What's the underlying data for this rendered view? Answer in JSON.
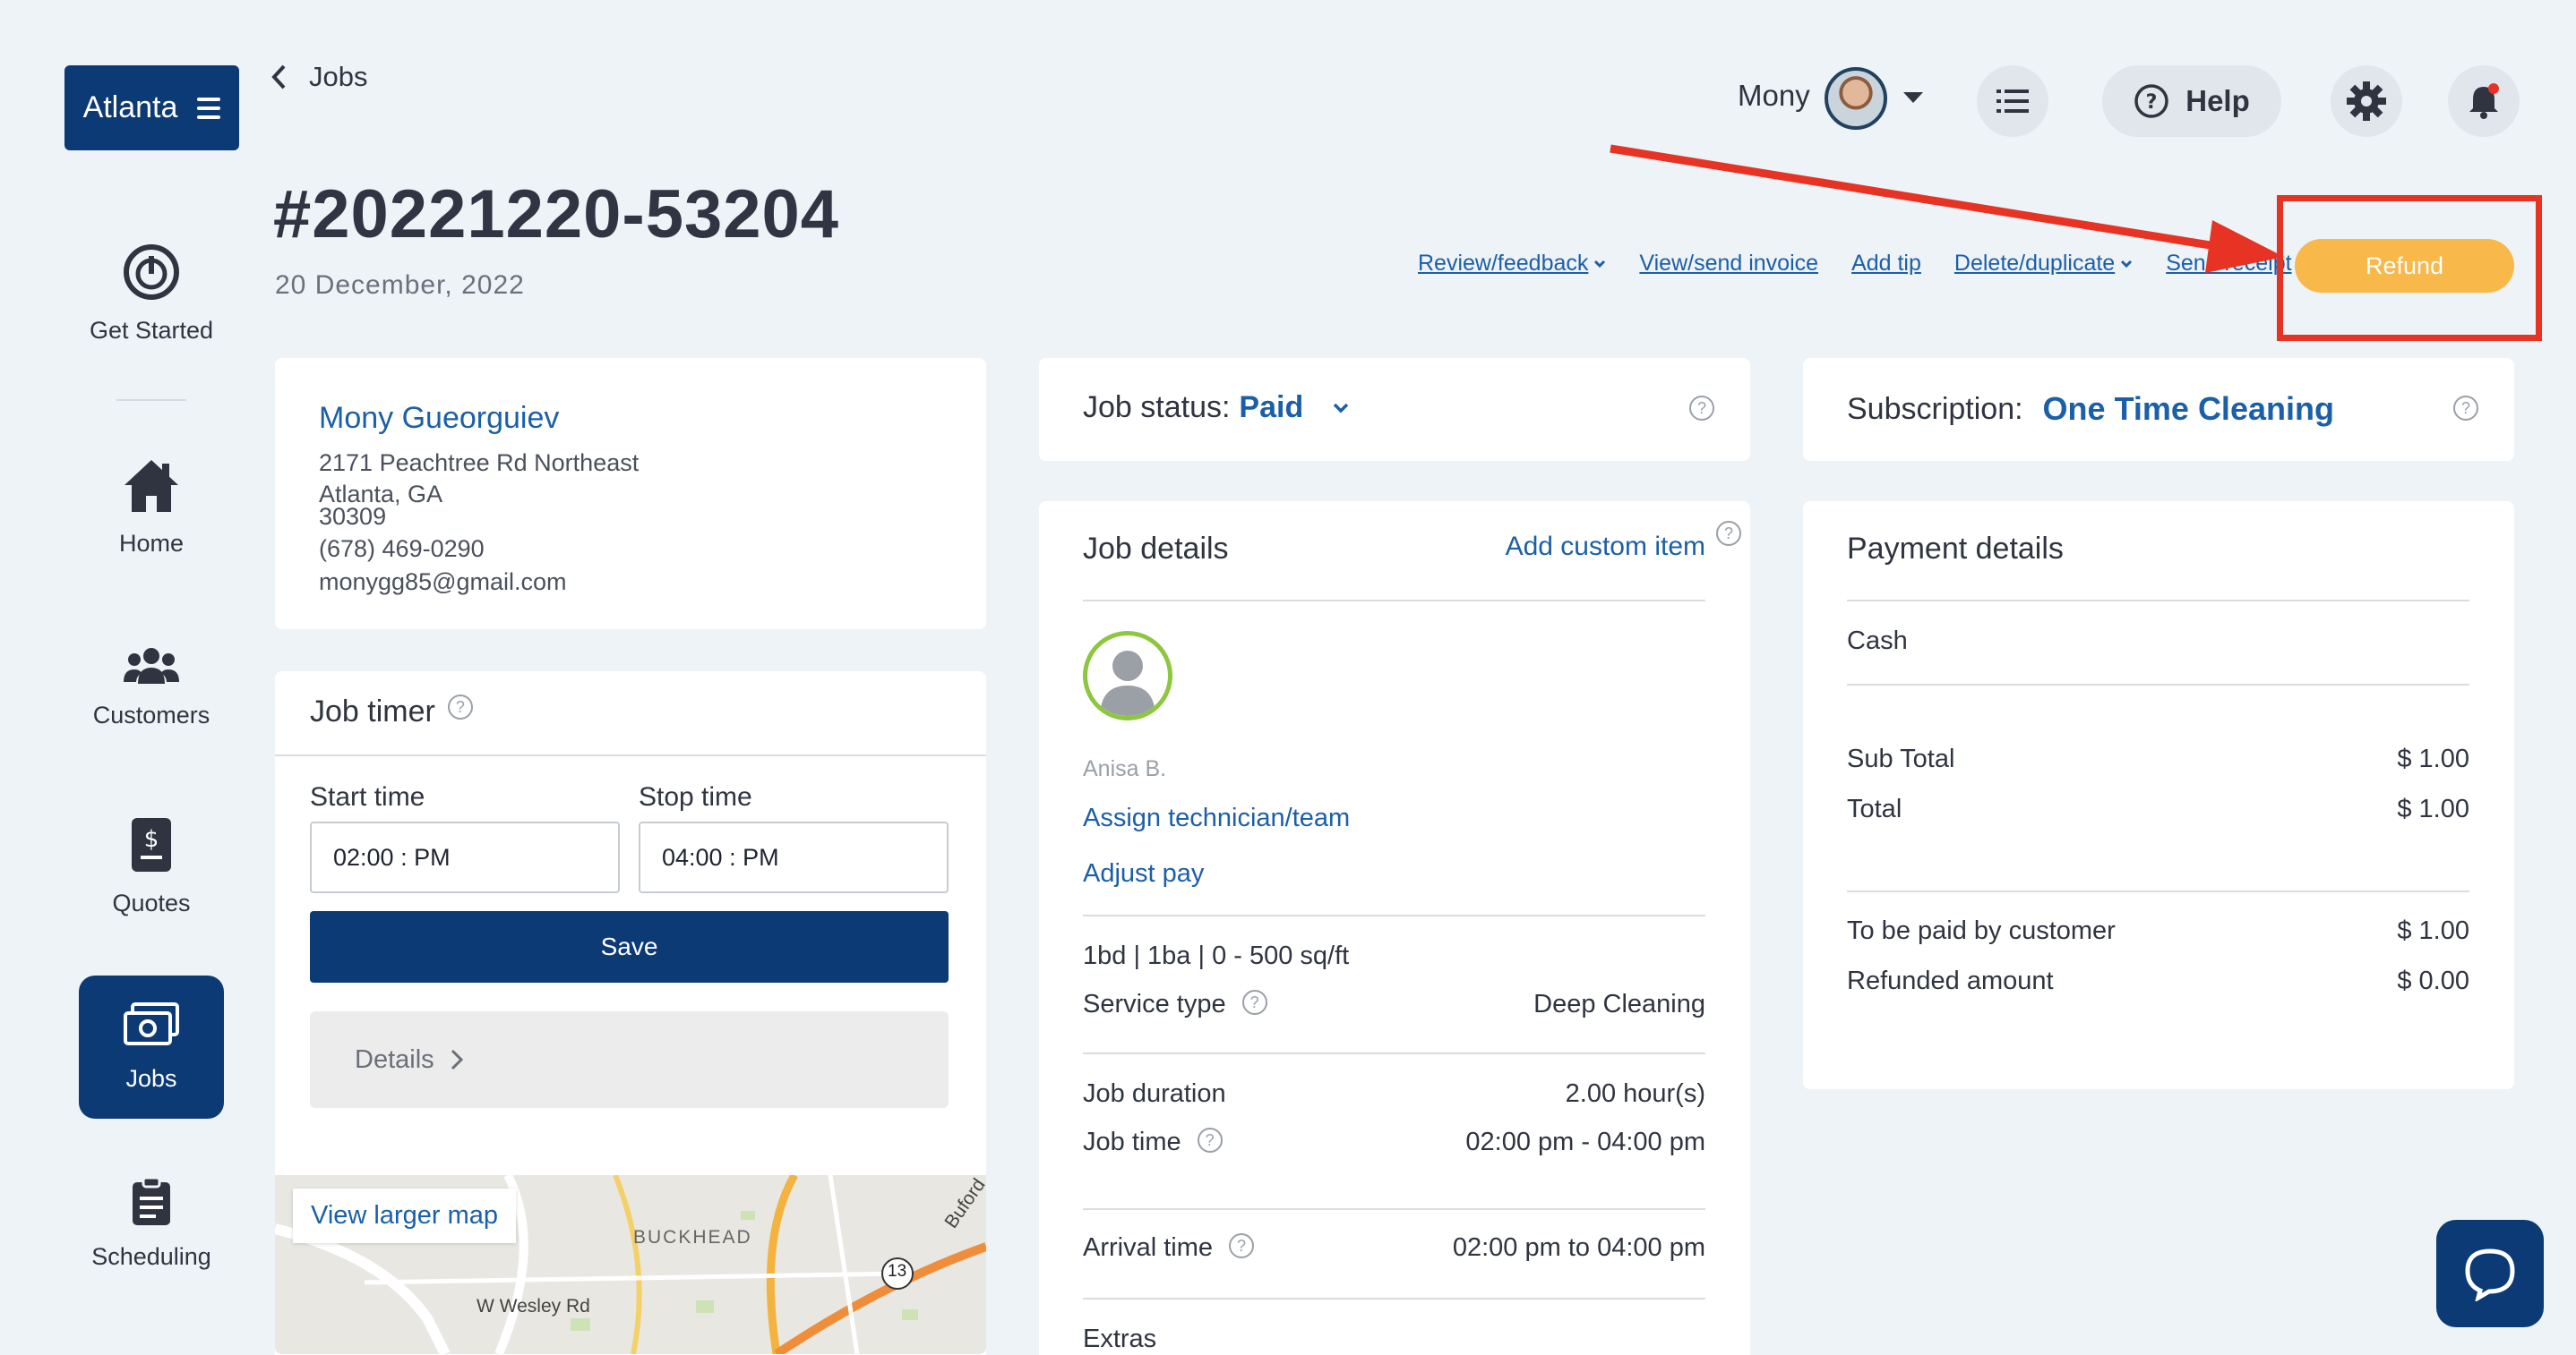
{
  "sidebar": {
    "brand": "Atlanta",
    "items": [
      {
        "label": "Get Started",
        "icon": "power-icon"
      },
      {
        "label": "Home",
        "icon": "home-icon"
      },
      {
        "label": "Customers",
        "icon": "customers-icon"
      },
      {
        "label": "Quotes",
        "icon": "quote-icon"
      },
      {
        "label": "Jobs",
        "icon": "jobs-icon",
        "active": true
      },
      {
        "label": "Scheduling",
        "icon": "clipboard-icon"
      }
    ]
  },
  "header": {
    "back_label": "Jobs",
    "job_number": "#20221220-53204",
    "job_date": "20 December, 2022",
    "user_name": "Mony",
    "help_label": "Help"
  },
  "actions": {
    "review": "Review/feedback",
    "invoice": "View/send invoice",
    "tip": "Add tip",
    "delete": "Delete/duplicate",
    "receipt": "Send receipt",
    "refund": "Refund"
  },
  "customer": {
    "name": "Mony Gueorguiev",
    "street": "2171 Peachtree Rd Northeast",
    "city": "Atlanta, GA",
    "zip": "30309",
    "phone": "(678) 469-0290",
    "email": "monygg85@gmail.com"
  },
  "timer": {
    "title": "Job timer",
    "start_label": "Start time",
    "stop_label": "Stop time",
    "start_value": "02:00 : PM",
    "stop_value": "04:00 : PM",
    "save_label": "Save",
    "details_label": "Details"
  },
  "map": {
    "link": "View larger map",
    "label_area": "BUCKHEAD",
    "label_road": "W Wesley Rd",
    "label_buford": "Buford",
    "route": "13"
  },
  "status": {
    "label": "Job status:",
    "value": "Paid"
  },
  "subscription": {
    "label": "Subscription:",
    "value": "One Time Cleaning"
  },
  "job_details": {
    "title": "Job details",
    "add_custom": "Add custom item",
    "tech_name": "Anisa B.",
    "assign": "Assign technician/team",
    "adjust_pay": "Adjust pay",
    "size": "1bd | 1ba | 0 - 500 sq/ft",
    "service_type_label": "Service type",
    "service_type_value": "Deep Cleaning",
    "duration_label": "Job duration",
    "duration_value": "2.00 hour(s)",
    "job_time_label": "Job time",
    "job_time_value": "02:00 pm - 04:00 pm",
    "arrival_label": "Arrival time",
    "arrival_value": "02:00 pm to 04:00 pm",
    "extras_label": "Extras"
  },
  "payment": {
    "title": "Payment details",
    "method": "Cash",
    "subtotal_label": "Sub Total",
    "subtotal_value": "$ 1.00",
    "total_label": "Total",
    "total_value": "$ 1.00",
    "to_pay_label": "To be paid by customer",
    "to_pay_value": "$ 1.00",
    "refunded_label": "Refunded amount",
    "refunded_value": "$ 0.00"
  },
  "colors": {
    "primary": "#0b3a75",
    "link": "#1b5fa8",
    "refund": "#f8b84a",
    "annotation": "#e63324"
  }
}
